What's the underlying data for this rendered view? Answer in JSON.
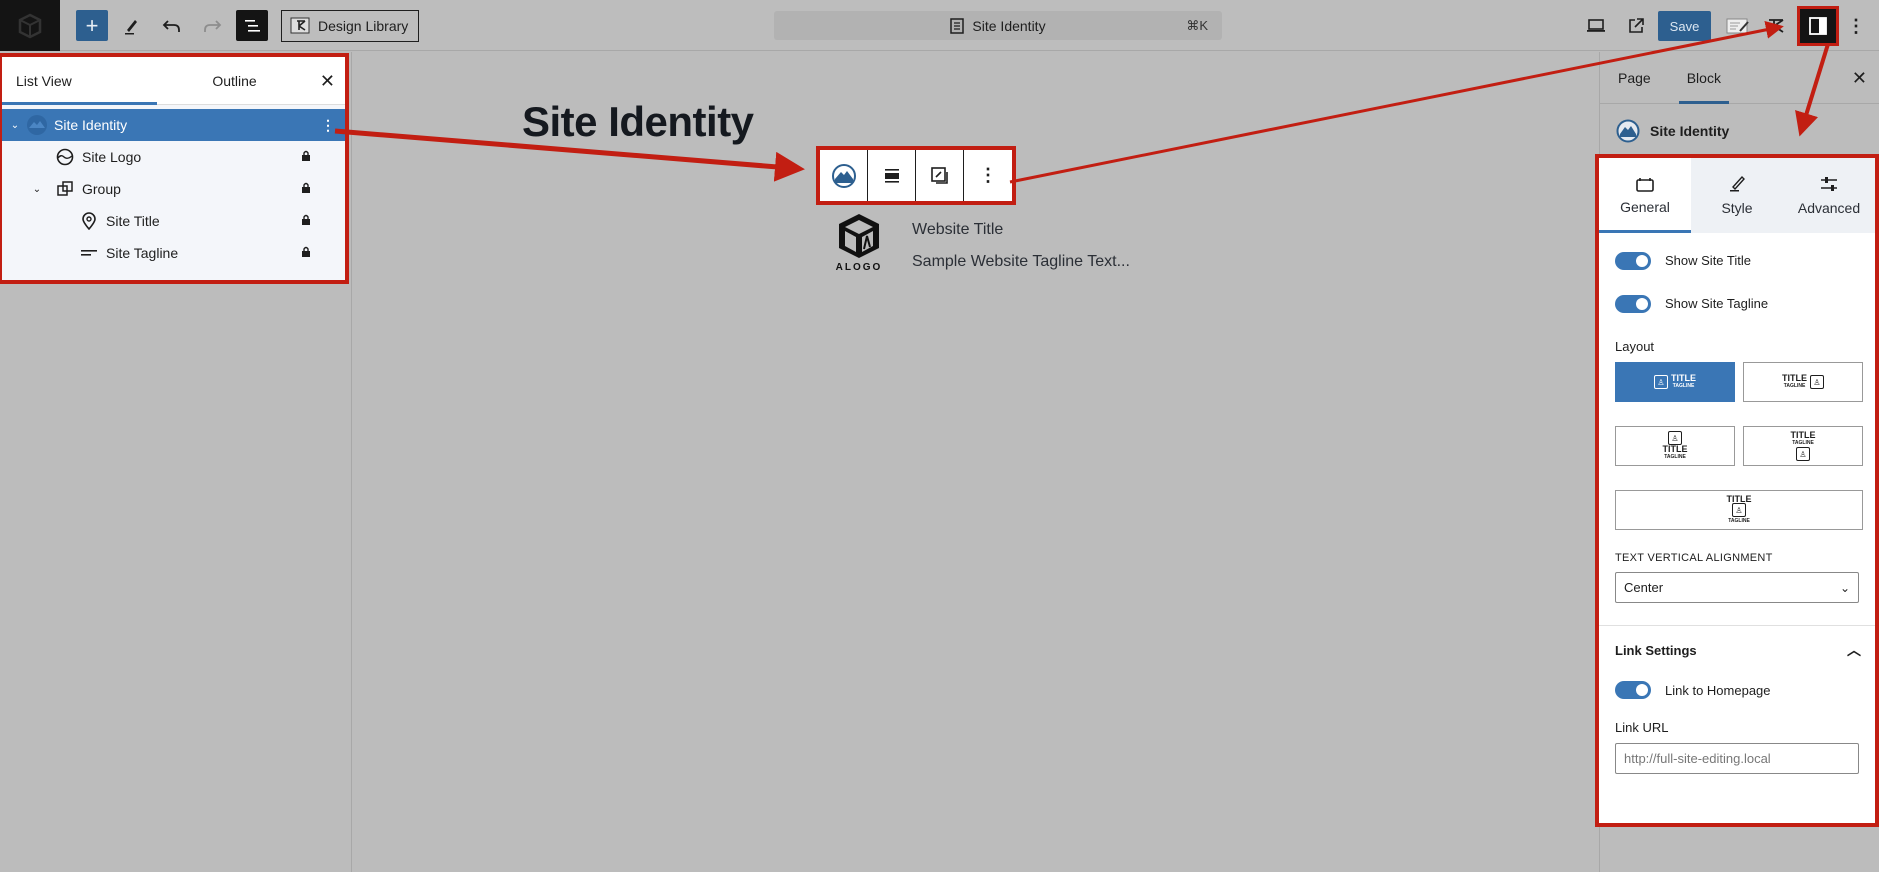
{
  "topbar": {
    "design_library_label": "Design Library",
    "command_title": "Site Identity",
    "command_shortcut": "⌘K",
    "save_label": "Save"
  },
  "list_view": {
    "tabs": [
      "List View",
      "Outline"
    ],
    "active_tab": "List View",
    "items": [
      {
        "label": "Site Identity",
        "icon": "site-identity-icon",
        "selected": true,
        "expanded": true,
        "locked": false
      },
      {
        "label": "Site Logo",
        "icon": "site-logo-icon",
        "locked": true
      },
      {
        "label": "Group",
        "icon": "group-icon",
        "expanded": true,
        "locked": true
      },
      {
        "label": "Site Title",
        "icon": "map-pin-icon",
        "locked": true
      },
      {
        "label": "Site Tagline",
        "icon": "tagline-icon",
        "locked": true
      }
    ]
  },
  "canvas": {
    "page_title": "Site Identity",
    "logo_text": "ALOGO",
    "website_title": "Website Title",
    "website_tagline": "Sample Website Tagline Text..."
  },
  "sidebar": {
    "tabs": [
      "Page",
      "Block"
    ],
    "active_tab": "Block",
    "block_name": "Site Identity",
    "panel_tabs": [
      "General",
      "Style",
      "Advanced"
    ],
    "active_panel_tab": "General",
    "toggles": [
      {
        "label": "Show Site Title",
        "on": true
      },
      {
        "label": "Show Site Tagline",
        "on": true
      }
    ],
    "layout_label": "Layout",
    "layout_title_text": "TITLE",
    "layout_tagline_text": "TAGLINE",
    "layout_selected_index": 0,
    "text_vertical_alignment_label": "TEXT VERTICAL ALIGNMENT",
    "text_vertical_alignment_value": "Center",
    "link_settings_label": "Link Settings",
    "link_toggle": {
      "label": "Link to Homepage",
      "on": true
    },
    "link_url_label": "Link URL",
    "link_url_placeholder": "http://full-site-editing.local"
  },
  "colors": {
    "accent": "#3a76b5",
    "save_blue": "#2d5f8f",
    "annotation_red": "#c21e12"
  }
}
